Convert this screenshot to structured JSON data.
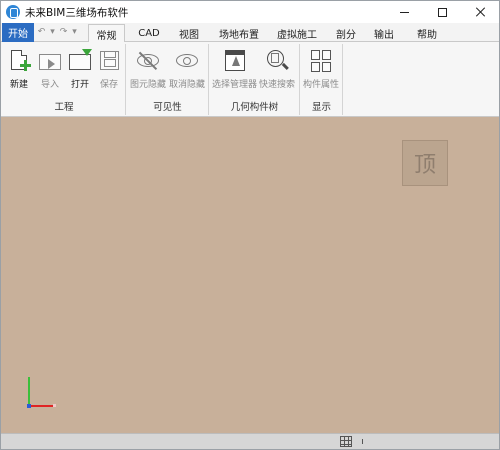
{
  "window": {
    "title": "未来BIM三维场布软件"
  },
  "tabs": {
    "start": "开始",
    "items": [
      "常规",
      "CAD",
      "视图",
      "场地布置",
      "虚拟施工",
      "剖分",
      "输出",
      "帮助"
    ],
    "active": "常规"
  },
  "quick_access": {
    "undo": "↶",
    "redo": "↷",
    "more": "▾"
  },
  "ribbon": {
    "groups": [
      {
        "label": "工程",
        "buttons": [
          "新建",
          "导入",
          "打开",
          "保存"
        ]
      },
      {
        "label": "可见性",
        "buttons": [
          "图元隐藏",
          "取消隐藏"
        ]
      },
      {
        "label": "几何构件树",
        "buttons": [
          "选择管理器",
          "快速搜索"
        ]
      },
      {
        "label": "显示",
        "buttons": [
          "构件属性"
        ]
      }
    ]
  },
  "viewport": {
    "background": "#c8b09a",
    "view_cube_label": "顶"
  },
  "icons": {
    "app": "app-logo-icon",
    "new": "new-document-icon",
    "import": "import-folder-icon",
    "open": "open-folder-icon",
    "save": "save-icon",
    "hide": "eye-slash-icon",
    "unhide": "eye-icon",
    "selection_manager": "selection-window-icon",
    "quick_search": "magnifier-icon",
    "properties": "component-blocks-icon",
    "grid": "grid-icon"
  },
  "colors": {
    "start_tab": "#2b6cc2",
    "viewport": "#c8b09a",
    "axis_x": "#e02424",
    "axis_y": "#3bbf3b",
    "axis_z": "#2a5bd7"
  }
}
